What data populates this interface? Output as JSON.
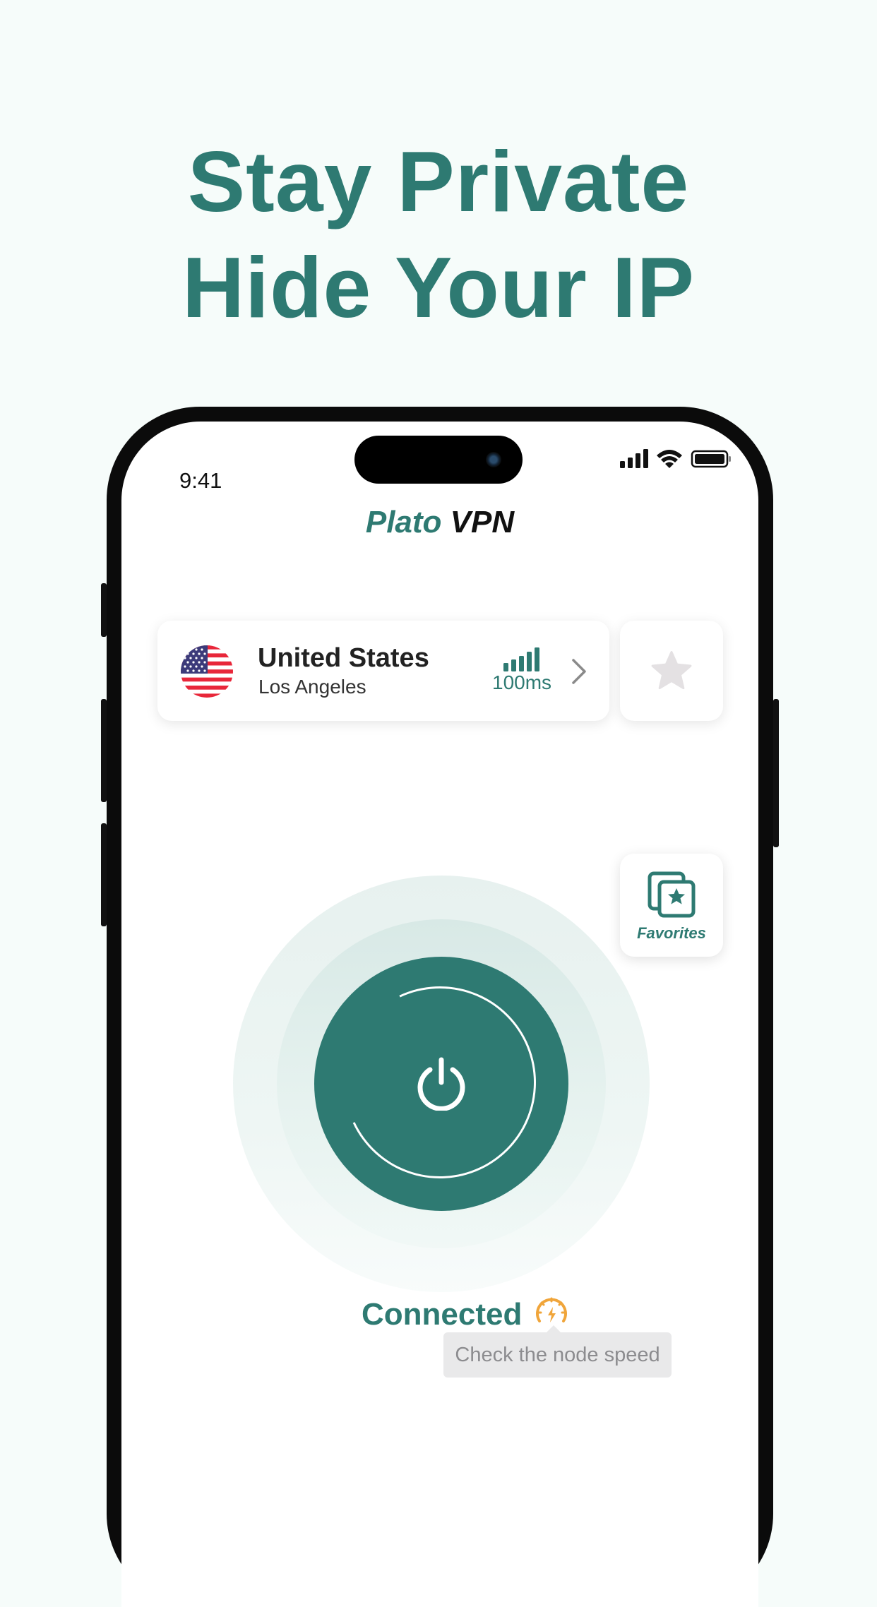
{
  "headline": {
    "line1": "Stay Private",
    "line2": "Hide Your IP"
  },
  "status_bar": {
    "time": "9:41"
  },
  "app": {
    "title_part1": "Plato",
    "title_part2": "VPN"
  },
  "server": {
    "country": "United States",
    "city": "Los Angeles",
    "ping": "100ms",
    "signal_icon": "signal-bars-icon",
    "flag_icon": "us-flag-icon"
  },
  "favorites": {
    "label": "Favorites",
    "icon": "favorites-star-icon"
  },
  "connection": {
    "status": "Connected",
    "tooltip": "Check the node speed",
    "speed_icon": "speedometer-icon"
  },
  "colors": {
    "accent": "#2e7a72",
    "background": "#f6fcfa",
    "speed_icon": "#f0a53a",
    "star_inactive": "#e4e1e3"
  }
}
